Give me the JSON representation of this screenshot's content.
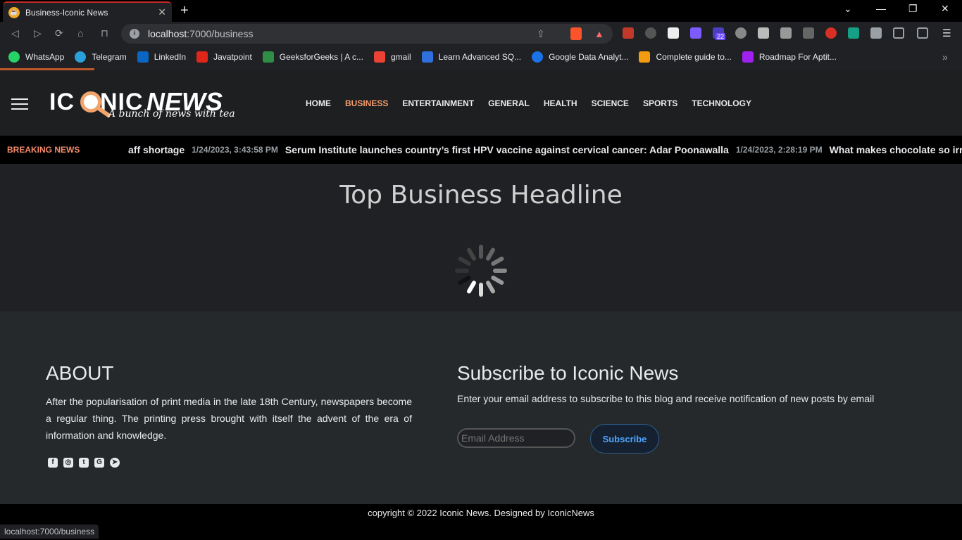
{
  "browser": {
    "tab_title": "Business-Iconic News",
    "url_host": "localhost",
    "url_path": ":7000/business",
    "status_url": "localhost:7000/business",
    "extension_badge": "22",
    "bookmarks": [
      {
        "label": "WhatsApp",
        "color": "#25d366"
      },
      {
        "label": "Telegram",
        "color": "#2aa1da"
      },
      {
        "label": "LinkedIn",
        "color": "#0a66c2"
      },
      {
        "label": "Javatpoint",
        "color": "#e0261b"
      },
      {
        "label": "GeeksforGeeks | A c...",
        "color": "#2f8d46"
      },
      {
        "label": "gmail",
        "color": "#ea4335"
      },
      {
        "label": "Learn Advanced SQ...",
        "color": "#2f6fde"
      },
      {
        "label": "Google Data Analyt...",
        "color": "#1a73e8"
      },
      {
        "label": "Complete guide to...",
        "color": "#f39c12"
      },
      {
        "label": "Roadmap For Aptit...",
        "color": "#a020f0"
      }
    ]
  },
  "site": {
    "logo_text_1": "IC",
    "logo_text_2": "NIC",
    "logo_text_3": "NEWS",
    "tagline": "A bunch of news with tea",
    "menu": [
      "HOME",
      "BUSINESS",
      "ENTERTAINMENT",
      "GENERAL",
      "HEALTH",
      "SCIENCE",
      "SPORTS",
      "TECHNOLOGY"
    ],
    "active_menu": "BUSINESS",
    "breaking_label": "BREAKING NEWS",
    "ticker": [
      {
        "headline": "aff shortage",
        "time": "1/24/2023, 3:43:58 PM"
      },
      {
        "headline": "Serum Institute launches country’s first HPV vaccine against cervical cancer: Adar Poonawalla",
        "time": "1/24/2023, 2:28:19 PM"
      },
      {
        "headline": "What makes chocolate so irre",
        "time": ""
      }
    ],
    "headline": "Top Business Headline"
  },
  "footer": {
    "about_title": "ABOUT",
    "about_text": "After the popularisation of print media in the late 18th Century, newspapers become a regular thing. The printing press brought with itself the advent of the era of information and knowledge.",
    "subscribe_title": "Subscribe to Iconic News",
    "subscribe_text": "Enter your email address to subscribe to this blog and receive notification of new posts by email",
    "email_placeholder": "Email Address",
    "subscribe_button": "Subscribe",
    "copyright": "copyright © 2022 Iconic News. Designed by IconicNews"
  }
}
